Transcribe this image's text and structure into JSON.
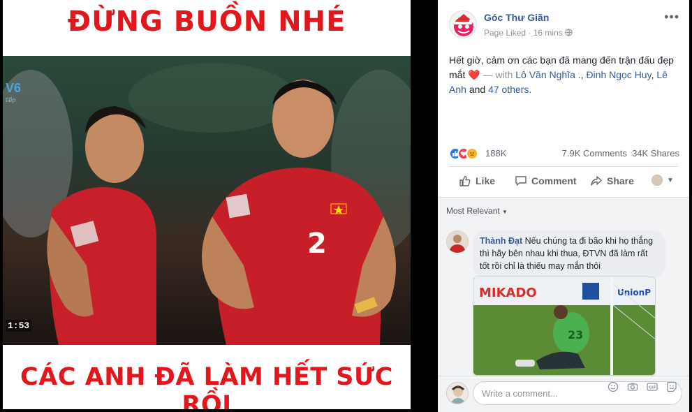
{
  "image_post": {
    "caption_top": "ĐỪNG BUỒN NHÉ",
    "caption_bottom": "CÁC ANH ĐÃ LÀM HẾT SỨC RỒI",
    "broadcast_logo": "V6",
    "broadcast_sub": "tiếp",
    "timer": "1:53",
    "jersey_number": "2"
  },
  "post": {
    "page_name": "Góc Thư Giãn",
    "meta_liked": "Page Liked",
    "meta_sep": "·",
    "meta_time": "16 mins",
    "more_label": "•••",
    "text_main": "Hết giờ, cảm ơn các bạn đã mang đến trận đấu đẹp mắt",
    "heart": "❤️",
    "with_label": "— with",
    "tag1": "Lô Văn Nghĩa .",
    "tag_sep1": ",",
    "tag2": "Đinh Ngọc Huy",
    "tag_sep2": ",",
    "tag3": "Lê Anh",
    "and_label": "and",
    "others": "47 others."
  },
  "stats": {
    "reactions": "188K",
    "comments": "7.9K Comments",
    "shares": "34K Shares"
  },
  "actions": {
    "like": "Like",
    "comment": "Comment",
    "share": "Share"
  },
  "comments": {
    "filter": "Most Relevant",
    "items": [
      {
        "author": "Thành Đạt",
        "text": "Nếu chúng ta đi bão khi họ thắng thì hãy bên nhau khi thua, ĐTVN đã làm rất tốt rồi chỉ là thiếu may mắn thôi",
        "image_banner": "MIKADO",
        "image_banner2": "UnionP",
        "image_number": "23"
      }
    ]
  },
  "composer": {
    "placeholder": "Write a comment..."
  },
  "colors": {
    "accent_red": "#e3161c",
    "fb_link": "#365899",
    "like_blue": "#2078f4",
    "heart_red": "#f33e58",
    "sad_yellow": "#f7b125"
  }
}
